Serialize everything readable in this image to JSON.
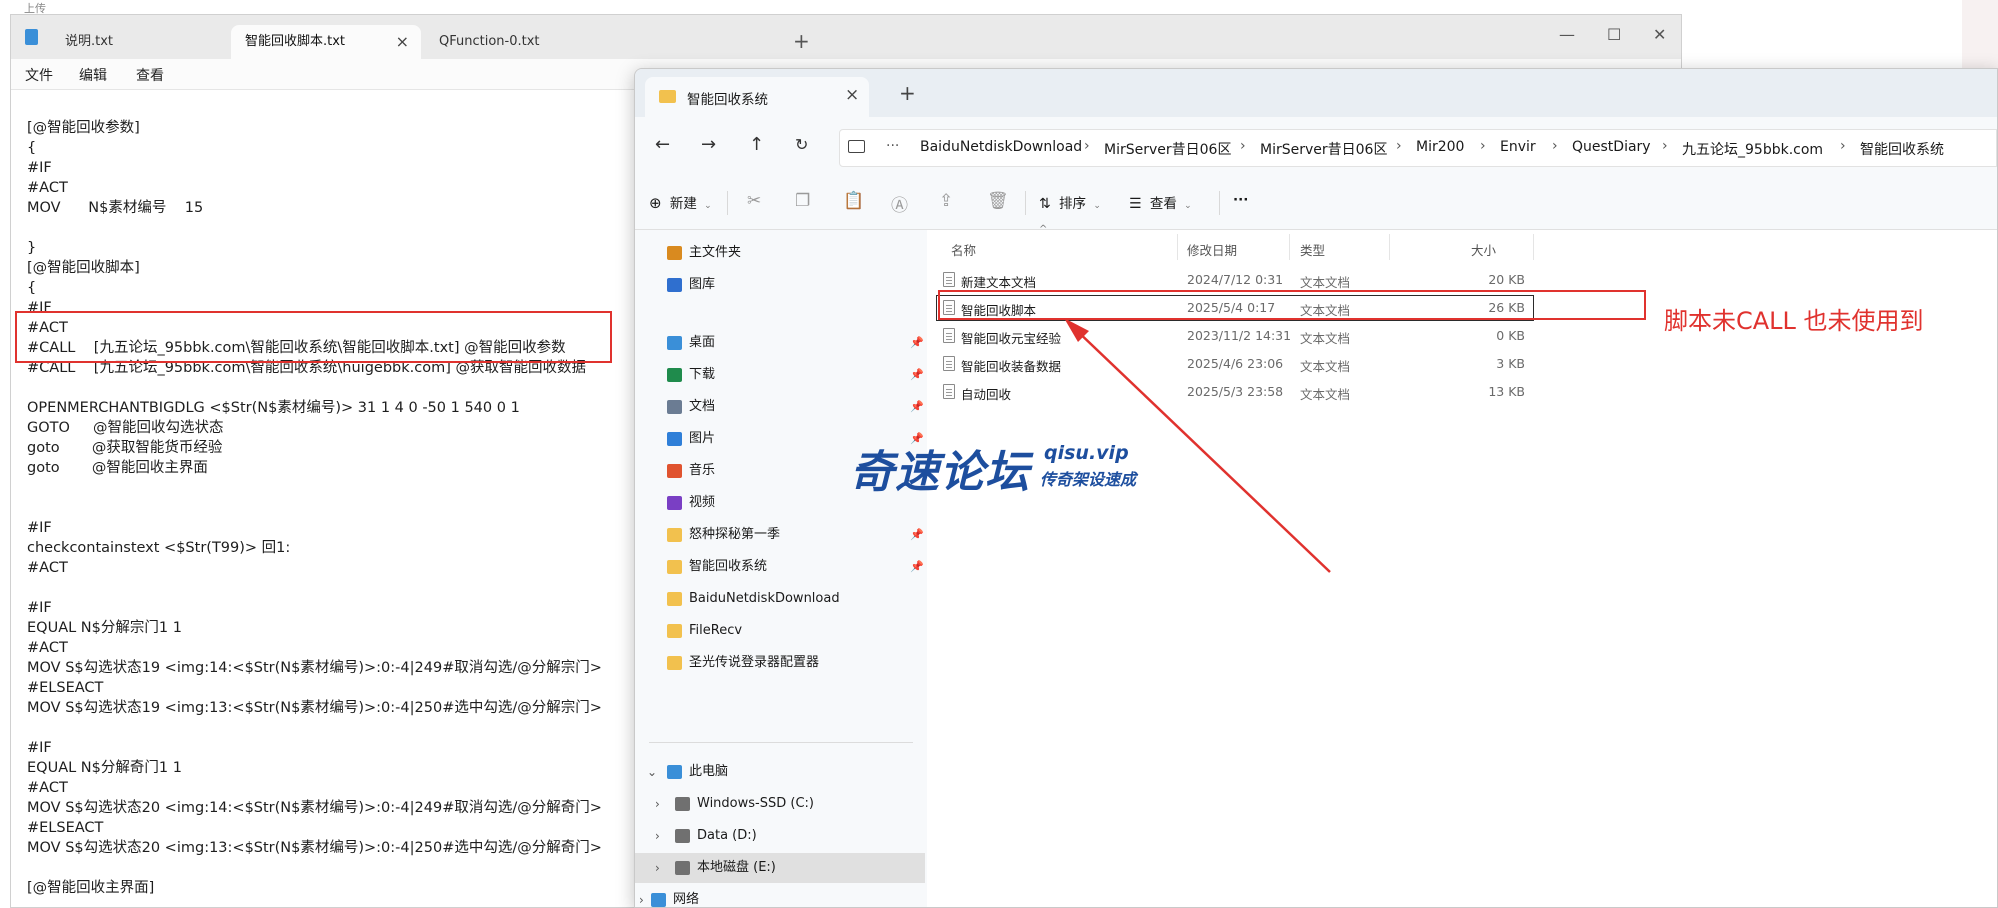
{
  "background": {
    "top_left_text": "上传"
  },
  "notepad": {
    "tabs": [
      {
        "label": "说明.txt",
        "active": false
      },
      {
        "label": "智能回收脚本.txt",
        "active": true
      },
      {
        "label": "QFunction-0.txt",
        "active": false
      }
    ],
    "new_tab": "+",
    "menu": [
      "文件",
      "编辑",
      "查看"
    ],
    "lines": [
      "[@智能回收参数]",
      "{",
      "#IF",
      "#ACT",
      "MOV      N$素材编号    15",
      "",
      "}",
      "[@智能回收脚本]",
      "{",
      "#IF",
      "#ACT",
      "#CALL    [九五论坛_95bbk.com\\智能回收系统\\智能回收脚本.txt] @智能回收参数",
      "#CALL    [九五论坛_95bbk.com\\智能回收系统\\huigebbk.com] @获取智能回收数据",
      "",
      "OPENMERCHANTBIGDLG <$Str(N$素材编号)> 31 1 4 0 -50 1 540 0 1",
      "GOTO     @智能回收勾选状态",
      "goto       @获取智能货币经验",
      "goto       @智能回收主界面",
      "",
      "",
      "#IF",
      "checkcontainstext <$Str(T99)> 回1:",
      "#ACT",
      "",
      "#IF",
      "EQUAL N$分解宗门1 1",
      "#ACT",
      "MOV S$勾选状态19 <img:14:<$Str(N$素材编号)>:0:-4|249#取消勾选/@分解宗门>",
      "#ELSEACT",
      "MOV S$勾选状态19 <img:13:<$Str(N$素材编号)>:0:-4|250#选中勾选/@分解宗门>",
      "",
      "#IF",
      "EQUAL N$分解奇门1 1",
      "#ACT",
      "MOV S$勾选状态20 <img:14:<$Str(N$素材编号)>:0:-4|249#取消勾选/@分解奇门>",
      "#ELSEACT",
      "MOV S$勾选状态20 <img:13:<$Str(N$素材编号)>:0:-4|250#选中勾选/@分解奇门>",
      "",
      "[@智能回收主界面]"
    ]
  },
  "explorer": {
    "tab_title": "智能回收系统",
    "breadcrumb": [
      "BaiduNetdiskDownload",
      "MirServer昔日06区",
      "MirServer昔日06区",
      "Mir200",
      "Envir",
      "QuestDiary",
      "九五论坛_95bbk.com",
      "智能回收系统"
    ],
    "toolbar": {
      "new_label": "新建",
      "sort_label": "排序",
      "view_label": "查看",
      "more_label": "···"
    },
    "sidebar": {
      "quick": [
        {
          "label": "主文件夹",
          "icon": "home-icon",
          "color": "#d98a1f"
        },
        {
          "label": "图库",
          "icon": "gallery-icon",
          "color": "#2f6fcf"
        }
      ],
      "pinned": [
        {
          "label": "桌面",
          "icon": "desktop-icon",
          "color": "#3a8fd8",
          "pinned": true
        },
        {
          "label": "下载",
          "icon": "download-icon",
          "color": "#1f8b4c",
          "pinned": true
        },
        {
          "label": "文档",
          "icon": "document-icon",
          "color": "#6b7c93",
          "pinned": true
        },
        {
          "label": "图片",
          "icon": "pictures-icon",
          "color": "#2f7fd8",
          "pinned": true
        },
        {
          "label": "音乐",
          "icon": "music-icon",
          "color": "#e0532f",
          "pinned": false
        },
        {
          "label": "视频",
          "icon": "video-icon",
          "color": "#7a3fc4",
          "pinned": false
        },
        {
          "label": "怒种探秘第一季",
          "icon": "folder-icon",
          "color": "#f2c14e",
          "pinned": true
        },
        {
          "label": "智能回收系统",
          "icon": "folder-icon",
          "color": "#f2c14e",
          "pinned": true
        },
        {
          "label": "BaiduNetdiskDownload",
          "icon": "folder-icon",
          "color": "#f2c14e",
          "pinned": false
        },
        {
          "label": "FileRecv",
          "icon": "folder-icon",
          "color": "#f2c14e",
          "pinned": false
        },
        {
          "label": "圣光传说登录器配置器",
          "icon": "folder-icon",
          "color": "#f2c14e",
          "pinned": false
        }
      ],
      "this_pc": {
        "label": "此电脑",
        "icon": "computer-icon",
        "color": "#3a8fd8"
      },
      "drives": [
        {
          "label": "Windows-SSD (C:)",
          "icon": "windows-drive-icon",
          "selected": false
        },
        {
          "label": "Data (D:)",
          "icon": "drive-icon",
          "selected": false
        },
        {
          "label": "本地磁盘 (E:)",
          "icon": "drive-icon",
          "selected": true
        }
      ],
      "network": {
        "label": "网络",
        "icon": "network-icon",
        "color": "#3a8fd8"
      }
    },
    "columns": {
      "name": "名称",
      "date": "修改日期",
      "type": "类型",
      "size": "大小"
    },
    "files": [
      {
        "name": "新建文本文档",
        "date": "2024/7/12 0:31",
        "type": "文本文档",
        "size": "20 KB",
        "focused": false
      },
      {
        "name": "智能回收脚本",
        "date": "2025/5/4 0:17",
        "type": "文本文档",
        "size": "26 KB",
        "focused": true
      },
      {
        "name": "智能回收元宝经验",
        "date": "2023/11/2 14:31",
        "type": "文本文档",
        "size": "0 KB",
        "focused": false
      },
      {
        "name": "智能回收装备数据",
        "date": "2025/4/6 23:06",
        "type": "文本文档",
        "size": "3 KB",
        "focused": false
      },
      {
        "name": "自动回收",
        "date": "2025/5/3 23:58",
        "type": "文本文档",
        "size": "13 KB",
        "focused": false
      }
    ]
  },
  "annotation": {
    "text": "脚本未CALL 也未使用到",
    "color": "#e0322e"
  },
  "watermark": {
    "main": "奇速论坛",
    "url": "qisu.vip",
    "sub": "传奇架设速成",
    "color": "#1d4e9e"
  }
}
